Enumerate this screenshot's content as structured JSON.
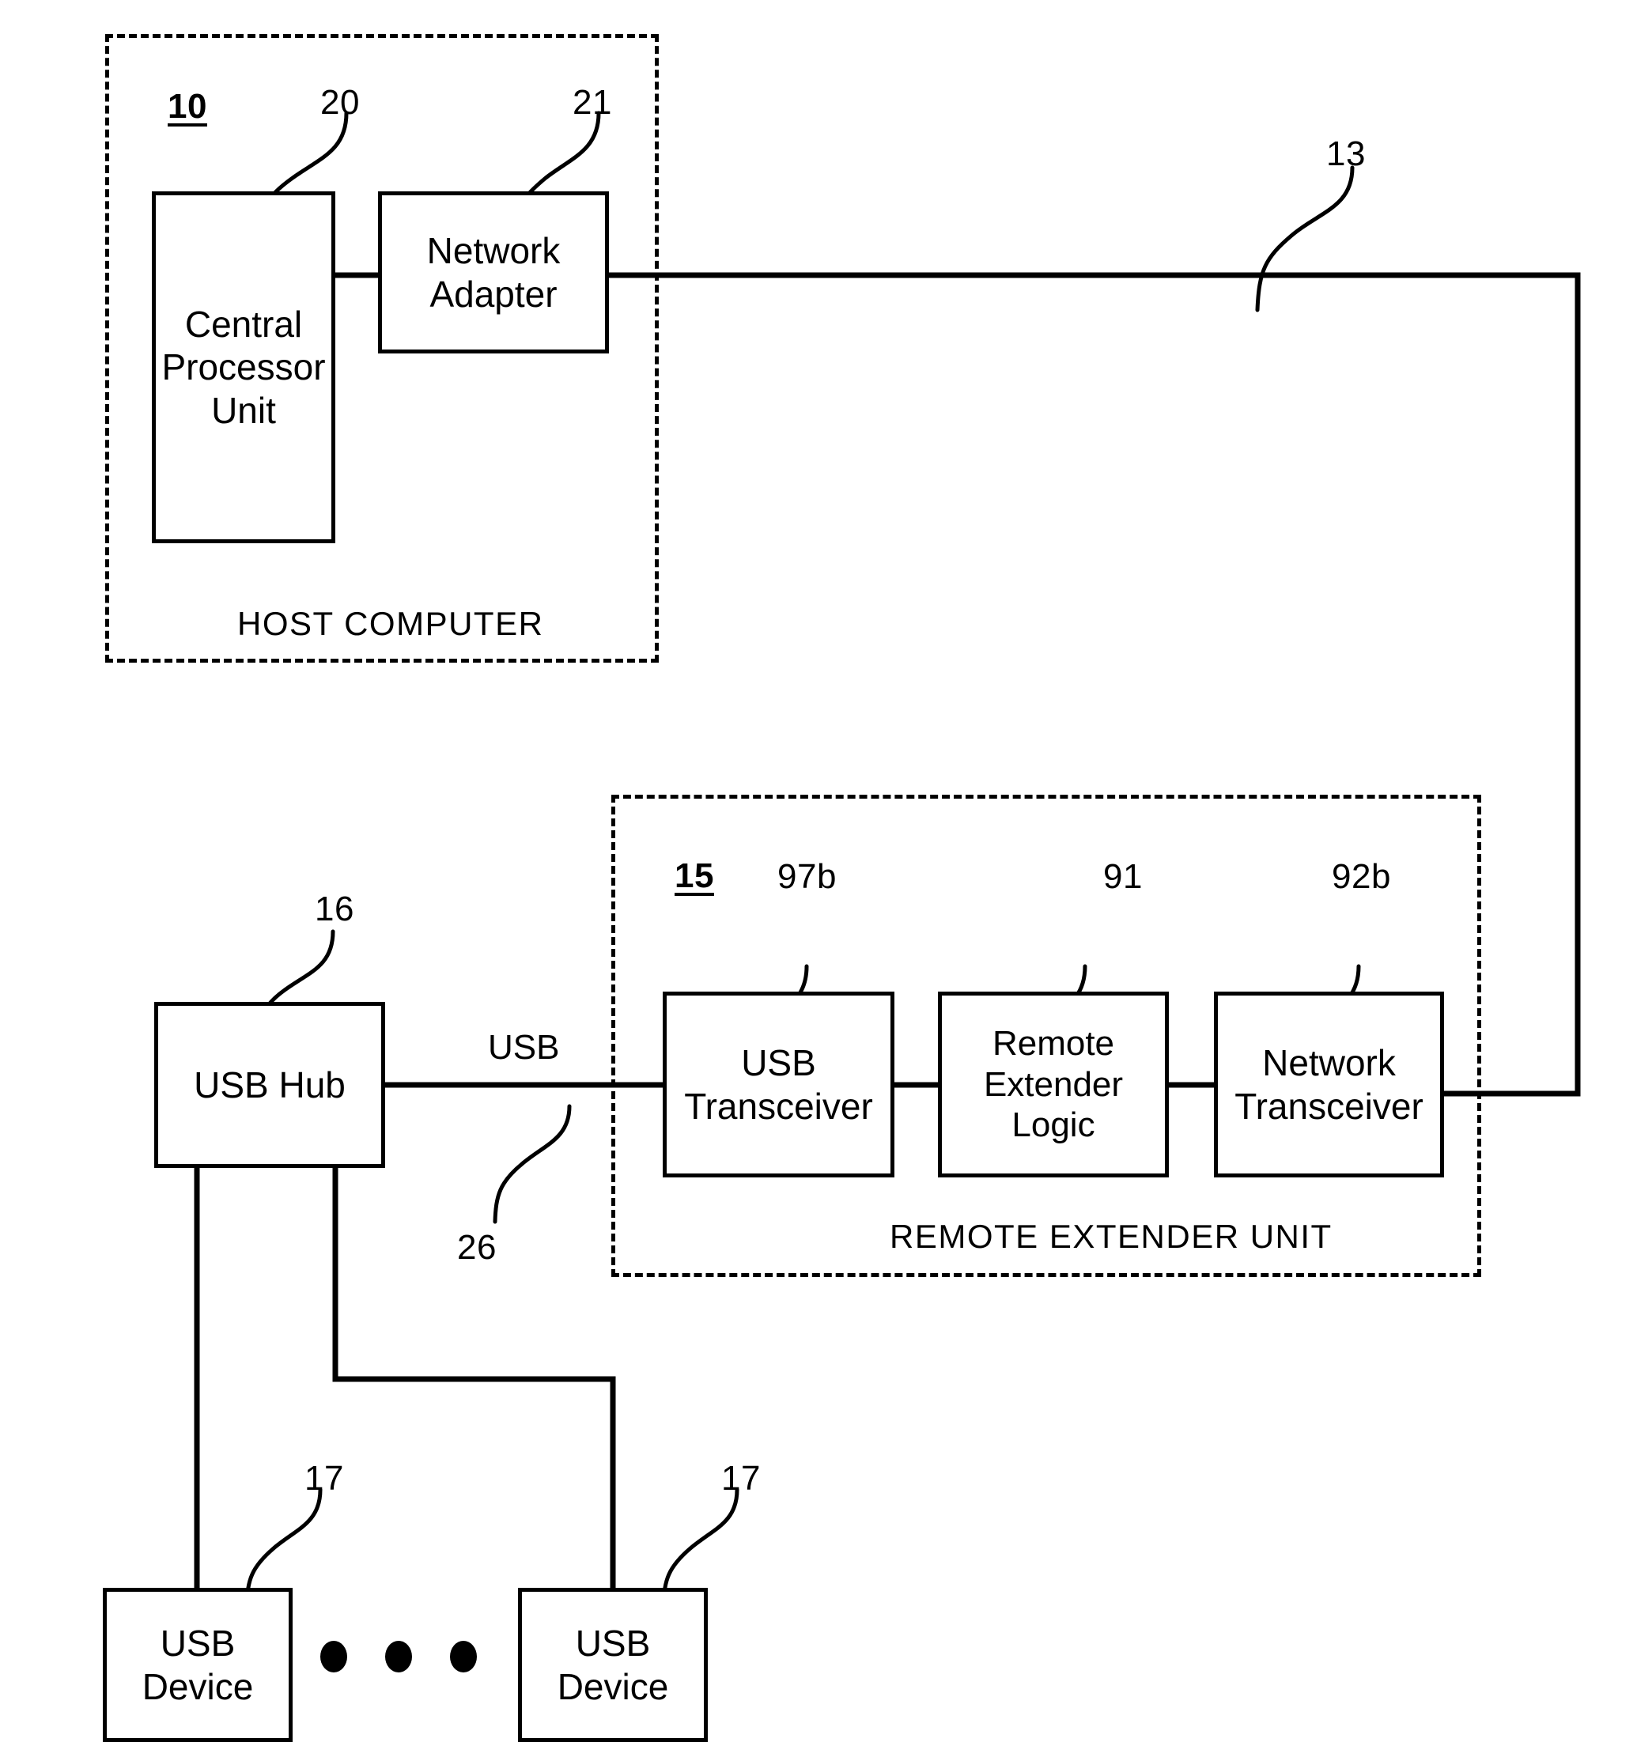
{
  "figure": {
    "kind": "patent-block-diagram",
    "title": "USB extender over network block diagram"
  },
  "groups": {
    "host": {
      "ref": "10",
      "caption": "HOST COMPUTER"
    },
    "remote": {
      "ref": "15",
      "caption": "REMOTE EXTENDER UNIT"
    }
  },
  "blocks": {
    "cpu": {
      "label": "Central\nProcessor\nUnit",
      "line1": "Central",
      "line2": "Processor",
      "line3": "Unit",
      "ref": "20"
    },
    "network_adapter": {
      "line1": "Network",
      "line2": "Adapter",
      "ref": "21"
    },
    "usb_hub": {
      "line1": "USB Hub",
      "ref": "16"
    },
    "usb_transceiver": {
      "line1": "USB",
      "line2": "Transceiver",
      "ref": "97b"
    },
    "remote_extender_logic": {
      "line1": "Remote",
      "line2": "Extender",
      "line3": "Logic",
      "ref": "91"
    },
    "network_transceiver": {
      "line1": "Network",
      "line2": "Transceiver",
      "ref": "92b"
    },
    "usb_device_left": {
      "line1": "USB",
      "line2": "Device",
      "ref": "17"
    },
    "usb_device_right": {
      "line1": "USB",
      "line2": "Device",
      "ref": "17"
    }
  },
  "connections": {
    "network_link": {
      "ref": "13",
      "label": ""
    },
    "usb_link": {
      "ref": "26",
      "label": "USB"
    }
  },
  "ellipsis": {
    "count": 3
  },
  "colors": {
    "stroke": "#000000",
    "background": "#ffffff"
  }
}
